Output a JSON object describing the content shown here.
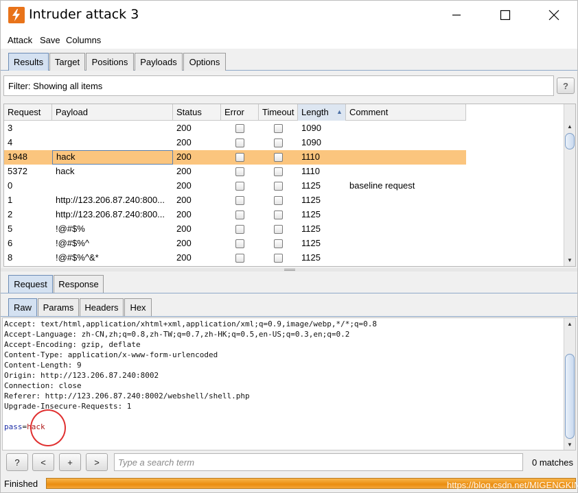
{
  "window": {
    "title": "Intruder attack 3"
  },
  "menu": [
    "Attack",
    "Save",
    "Columns"
  ],
  "main_tabs": [
    {
      "label": "Results",
      "active": true
    },
    {
      "label": "Target",
      "active": false
    },
    {
      "label": "Positions",
      "active": false
    },
    {
      "label": "Payloads",
      "active": false
    },
    {
      "label": "Options",
      "active": false
    }
  ],
  "filter": {
    "text": "Filter: Showing all items",
    "help": "?"
  },
  "results_table": {
    "columns": [
      "Request",
      "Payload",
      "Status",
      "Error",
      "Timeout",
      "Length",
      "Comment"
    ],
    "sorted_column": "Length",
    "sort_indicator": "▲",
    "rows": [
      {
        "request": "3",
        "payload": "",
        "status": "200",
        "error": false,
        "timeout": false,
        "length": "1090",
        "comment": ""
      },
      {
        "request": "4",
        "payload": "",
        "status": "200",
        "error": false,
        "timeout": false,
        "length": "1090",
        "comment": ""
      },
      {
        "request": "1948",
        "payload": "hack",
        "status": "200",
        "error": false,
        "timeout": false,
        "length": "1110",
        "comment": "",
        "selected": true
      },
      {
        "request": "5372",
        "payload": "hack",
        "status": "200",
        "error": false,
        "timeout": false,
        "length": "1110",
        "comment": ""
      },
      {
        "request": "0",
        "payload": "",
        "status": "200",
        "error": false,
        "timeout": false,
        "length": "1125",
        "comment": "baseline request"
      },
      {
        "request": "1",
        "payload": "http://123.206.87.240:800...",
        "status": "200",
        "error": false,
        "timeout": false,
        "length": "1125",
        "comment": ""
      },
      {
        "request": "2",
        "payload": "http://123.206.87.240:800...",
        "status": "200",
        "error": false,
        "timeout": false,
        "length": "1125",
        "comment": ""
      },
      {
        "request": "5",
        "payload": "!@#$%",
        "status": "200",
        "error": false,
        "timeout": false,
        "length": "1125",
        "comment": ""
      },
      {
        "request": "6",
        "payload": "!@#$%^",
        "status": "200",
        "error": false,
        "timeout": false,
        "length": "1125",
        "comment": ""
      },
      {
        "request": "8",
        "payload": "!@#$%^&*",
        "status": "200",
        "error": false,
        "timeout": false,
        "length": "1125",
        "comment": ""
      }
    ]
  },
  "detail_tabs": [
    {
      "label": "Request",
      "active": true
    },
    {
      "label": "Response",
      "active": false
    }
  ],
  "view_tabs": [
    {
      "label": "Raw",
      "active": true
    },
    {
      "label": "Params",
      "active": false
    },
    {
      "label": "Headers",
      "active": false
    },
    {
      "label": "Hex",
      "active": false
    }
  ],
  "request_body": {
    "lines": [
      "Accept: text/html,application/xhtml+xml,application/xml;q=0.9,image/webp,*/*;q=0.8",
      "Accept-Language: zh-CN,zh;q=0.8,zh-TW;q=0.7,zh-HK;q=0.5,en-US;q=0.3,en;q=0.2",
      "Accept-Encoding: gzip, deflate",
      "Content-Type: application/x-www-form-urlencoded",
      "Content-Length: 9",
      "Origin: http://123.206.87.240:8002",
      "Connection: close",
      "Referer: http://123.206.87.240:8002/webshell/shell.php",
      "Upgrade-Insecure-Requests: 1",
      ""
    ],
    "param_name": "pass",
    "param_sep": "=",
    "param_value": "hack"
  },
  "search": {
    "help": "?",
    "prev": "<",
    "add": "+",
    "next": ">",
    "placeholder": "Type a search term",
    "matches": "0 matches"
  },
  "status": {
    "text": "Finished",
    "progress": 1.0,
    "watermark": "https://blog.csdn.net/MIGENGKING"
  },
  "colors": {
    "selected_row": "#fbc57e",
    "brand_orange": "#e8731a",
    "active_tab": "#d4e1f1",
    "annotation": "#e03030"
  },
  "icons": {
    "app": "burp-lightning-icon",
    "minimize": "minimize-icon",
    "maximize": "maximize-icon",
    "close": "close-icon"
  }
}
